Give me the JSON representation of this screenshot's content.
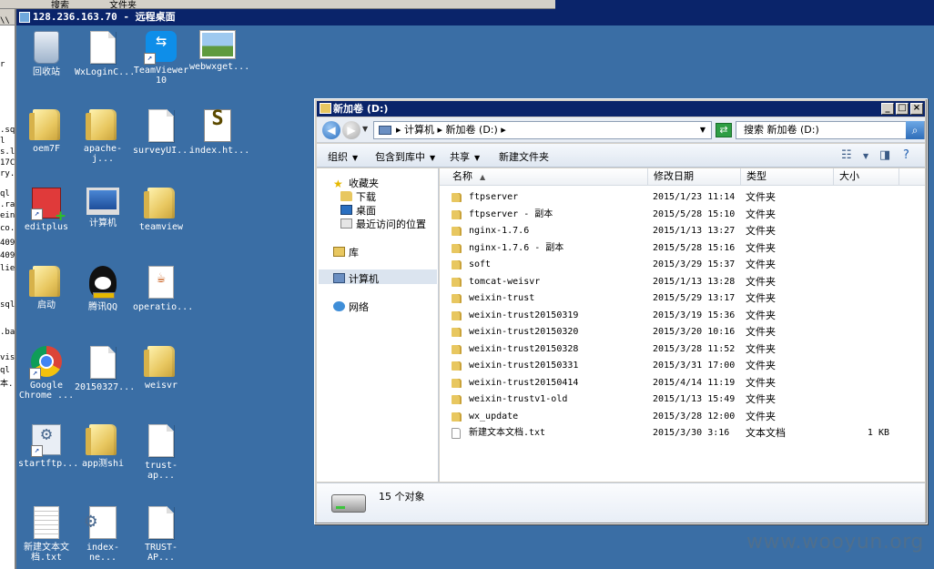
{
  "host_toolbar": {
    "search_label": "搜索",
    "folders_label": "文件夹"
  },
  "rdp_window": {
    "title": "128.236.163.70 - 远程桌面"
  },
  "left_strip": {
    "fragments": [
      "\\\\",
      "r",
      "l",
      ".sq",
      "s.lo",
      "17C",
      "ry.",
      "ql",
      ".ra",
      "ein",
      "co.",
      "409",
      "409",
      "lie",
      "sql",
      ".ba",
      "vis",
      "ql",
      "本."
    ]
  },
  "desktop_icons": [
    {
      "label": "回收站",
      "icon": "recycle-bin-icon"
    },
    {
      "label": "WxLoginC...",
      "icon": "document-icon"
    },
    {
      "label": "TeamViewer 10",
      "icon": "teamviewer-icon"
    },
    {
      "label": "webwxget...",
      "icon": "image-icon"
    },
    {
      "label": "oem7F",
      "icon": "folder-icon"
    },
    {
      "label": "apache-j...",
      "icon": "folder-icon"
    },
    {
      "label": "surveyUI...",
      "icon": "document-icon"
    },
    {
      "label": "index.ht...",
      "icon": "script-icon"
    },
    {
      "label": "editplus",
      "icon": "editplus-icon"
    },
    {
      "label": "计算机",
      "icon": "computer-icon"
    },
    {
      "label": "teamview",
      "icon": "folder-icon"
    },
    {
      "label": "启动",
      "icon": "folder-icon"
    },
    {
      "label": "腾讯QQ",
      "icon": "qq-icon"
    },
    {
      "label": "operatio...",
      "icon": "java-icon"
    },
    {
      "label": "Google Chrome ...",
      "icon": "chrome-icon"
    },
    {
      "label": "20150327...",
      "icon": "document-icon"
    },
    {
      "label": "weisvr",
      "icon": "folder-icon"
    },
    {
      "label": "startftp...",
      "icon": "setup-icon"
    },
    {
      "label": "app测shi",
      "icon": "folder-icon"
    },
    {
      "label": "trust-ap...",
      "icon": "document-icon"
    },
    {
      "label": "新建文本文档.txt",
      "icon": "text-file-icon"
    },
    {
      "label": "index-ne...",
      "icon": "gear-document-icon"
    },
    {
      "label": "TRUST-AP...",
      "icon": "document-icon"
    }
  ],
  "explorer": {
    "title": "新加卷 (D:)",
    "address_path": "▸ 计算机 ▸ 新加卷 (D:) ▸",
    "search_placeholder": "搜索 新加卷 (D:)",
    "toolbar": {
      "organize": "组织",
      "include_in_library": "包含到库中",
      "share": "共享",
      "new_folder": "新建文件夹"
    },
    "nav_pane": {
      "favorites": "收藏夹",
      "downloads": "下载",
      "desktop": "桌面",
      "recent_places": "最近访问的位置",
      "libraries": "库",
      "computer": "计算机",
      "network": "网络"
    },
    "columns": {
      "name": "名称",
      "modified": "修改日期",
      "type": "类型",
      "size": "大小"
    },
    "files": [
      {
        "name": "ftpserver",
        "modified": "2015/1/23 11:14",
        "type": "文件夹",
        "size": ""
      },
      {
        "name": "ftpserver - 副本",
        "modified": "2015/5/28 15:10",
        "type": "文件夹",
        "size": ""
      },
      {
        "name": "nginx-1.7.6",
        "modified": "2015/1/13 13:27",
        "type": "文件夹",
        "size": ""
      },
      {
        "name": "nginx-1.7.6 - 副本",
        "modified": "2015/5/28 15:16",
        "type": "文件夹",
        "size": ""
      },
      {
        "name": "soft",
        "modified": "2015/3/29 15:37",
        "type": "文件夹",
        "size": ""
      },
      {
        "name": "tomcat-weisvr",
        "modified": "2015/1/13 13:28",
        "type": "文件夹",
        "size": ""
      },
      {
        "name": "weixin-trust",
        "modified": "2015/5/29 13:17",
        "type": "文件夹",
        "size": ""
      },
      {
        "name": "weixin-trust20150319",
        "modified": "2015/3/19 15:36",
        "type": "文件夹",
        "size": ""
      },
      {
        "name": "weixin-trust20150320",
        "modified": "2015/3/20 10:16",
        "type": "文件夹",
        "size": ""
      },
      {
        "name": "weixin-trust20150328",
        "modified": "2015/3/28 11:52",
        "type": "文件夹",
        "size": ""
      },
      {
        "name": "weixin-trust20150331",
        "modified": "2015/3/31 17:00",
        "type": "文件夹",
        "size": ""
      },
      {
        "name": "weixin-trust20150414",
        "modified": "2015/4/14 11:19",
        "type": "文件夹",
        "size": ""
      },
      {
        "name": "weixin-trustv1-old",
        "modified": "2015/1/13 15:49",
        "type": "文件夹",
        "size": ""
      },
      {
        "name": "wx_update",
        "modified": "2015/3/28 12:00",
        "type": "文件夹",
        "size": ""
      },
      {
        "name": "新建文本文档.txt",
        "modified": "2015/3/30 3:16",
        "type": "文本文档",
        "size": "1 KB"
      }
    ],
    "status": {
      "object_count": "15 个对象"
    }
  },
  "watermark": "www.wooyun.org"
}
